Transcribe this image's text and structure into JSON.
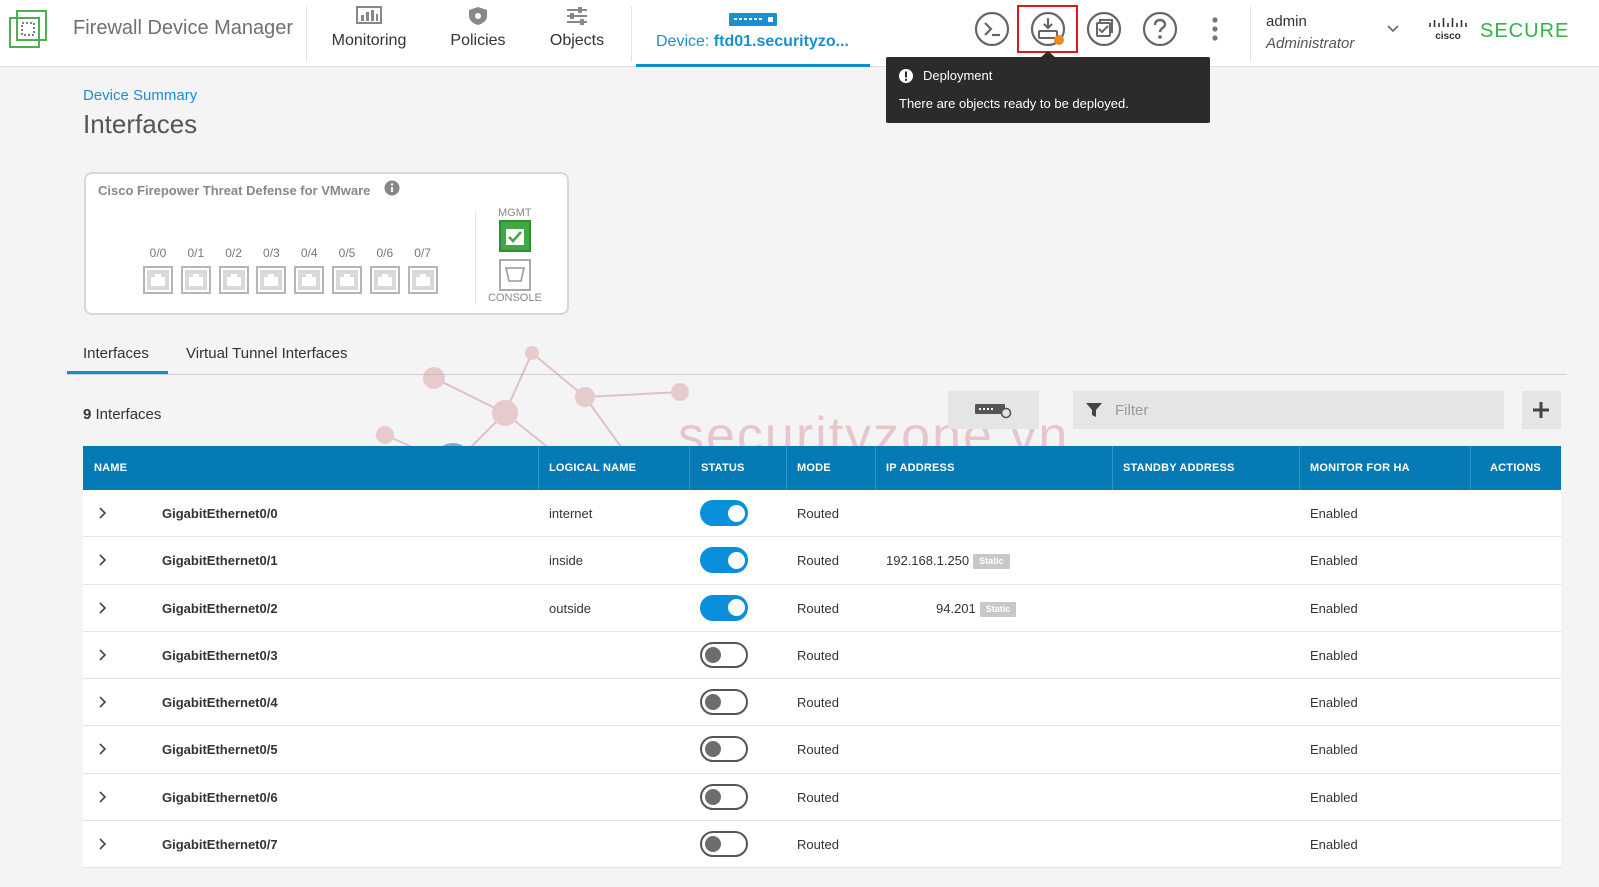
{
  "header": {
    "app_title": "Firewall Device Manager",
    "nav": [
      {
        "label": "Monitoring",
        "icon": "monitoring-icon"
      },
      {
        "label": "Policies",
        "icon": "policies-shield-icon"
      },
      {
        "label": "Objects",
        "icon": "objects-sliders-icon"
      }
    ],
    "device_prefix": "Device: ",
    "device_name": "ftd01.securityzo...",
    "toolbar_icons": [
      "cli-console-icon",
      "deployment-icon",
      "task-list-icon",
      "help-icon",
      "more-options-icon"
    ],
    "user": {
      "name": "admin",
      "role": "Administrator"
    },
    "brand": "SECURE",
    "brand_logo_text": "cisco"
  },
  "tooltip": {
    "title": "Deployment",
    "text": "There are objects ready to be deployed."
  },
  "page": {
    "breadcrumb": "Device Summary",
    "title": "Interfaces"
  },
  "device_card": {
    "title": "Cisco Firepower Threat Defense for VMware",
    "ports": [
      "0/0",
      "0/1",
      "0/2",
      "0/3",
      "0/4",
      "0/5",
      "0/6",
      "0/7"
    ],
    "mgmt_label": "MGMT",
    "console_label": "CONSOLE"
  },
  "subtabs": [
    "Interfaces",
    "Virtual Tunnel Interfaces"
  ],
  "interfaces_count": "9",
  "interfaces_count_label": "Interfaces",
  "filter_placeholder": "Filter",
  "table": {
    "columns": [
      "NAME",
      "LOGICAL NAME",
      "STATUS",
      "MODE",
      "IP ADDRESS",
      "STANDBY ADDRESS",
      "MONITOR FOR HA",
      "ACTIONS"
    ],
    "rows": [
      {
        "name": "GigabitEthernet0/0",
        "logical": "internet",
        "enabled": true,
        "mode": "Routed",
        "ip": "",
        "ip_tag": "",
        "standby": "",
        "ha": "Enabled"
      },
      {
        "name": "GigabitEthernet0/1",
        "logical": "inside",
        "enabled": true,
        "mode": "Routed",
        "ip": "192.168.1.250",
        "ip_tag": "Static",
        "standby": "",
        "ha": "Enabled"
      },
      {
        "name": "GigabitEthernet0/2",
        "logical": "outside",
        "enabled": true,
        "mode": "Routed",
        "ip": "94.201",
        "ip_tag": "Static",
        "standby": "",
        "ha": "Enabled"
      },
      {
        "name": "GigabitEthernet0/3",
        "logical": "",
        "enabled": false,
        "mode": "Routed",
        "ip": "",
        "ip_tag": "",
        "standby": "",
        "ha": "Enabled"
      },
      {
        "name": "GigabitEthernet0/4",
        "logical": "",
        "enabled": false,
        "mode": "Routed",
        "ip": "",
        "ip_tag": "",
        "standby": "",
        "ha": "Enabled"
      },
      {
        "name": "GigabitEthernet0/5",
        "logical": "",
        "enabled": false,
        "mode": "Routed",
        "ip": "",
        "ip_tag": "",
        "standby": "",
        "ha": "Enabled"
      },
      {
        "name": "GigabitEthernet0/6",
        "logical": "",
        "enabled": false,
        "mode": "Routed",
        "ip": "",
        "ip_tag": "",
        "standby": "",
        "ha": "Enabled"
      },
      {
        "name": "GigabitEthernet0/7",
        "logical": "",
        "enabled": false,
        "mode": "Routed",
        "ip": "",
        "ip_tag": "",
        "standby": "",
        "ha": "Enabled"
      }
    ]
  },
  "watermark": "securityzone.vn",
  "colors": {
    "accent": "#0f8fcf",
    "table_header": "#067ab4",
    "toggle_on": "#0a8fdc",
    "brand_green": "#2fb34a",
    "highlight": "#e01818",
    "notify_dot": "#f08a1e"
  }
}
